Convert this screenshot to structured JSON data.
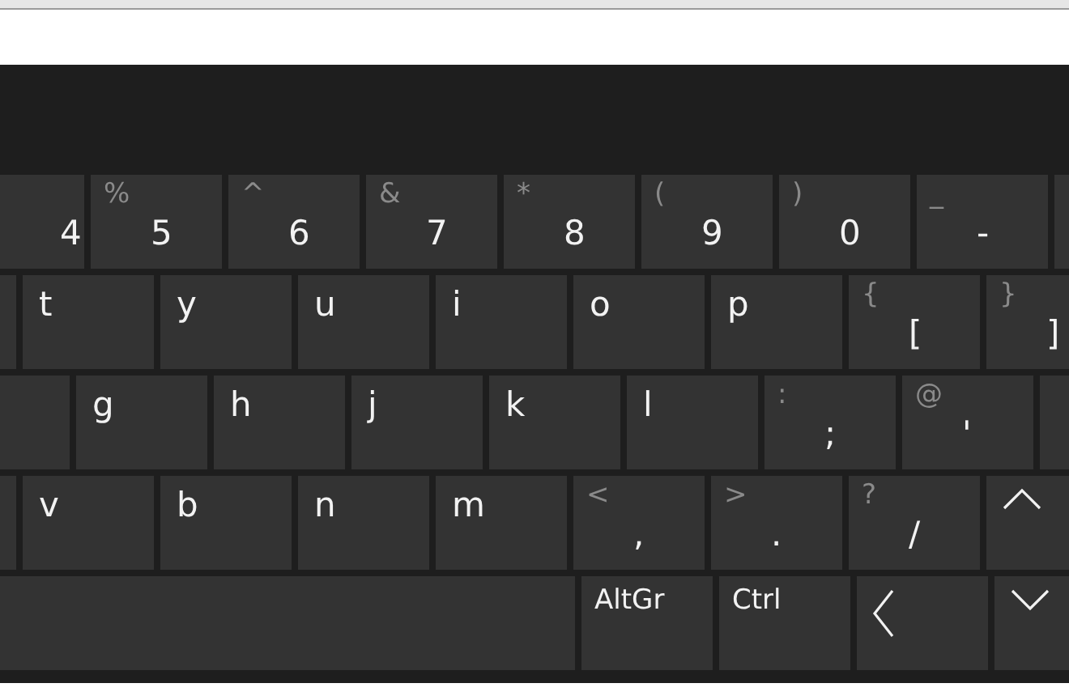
{
  "keyboard": {
    "rows": [
      {
        "keys": [
          {
            "kind": "symbol",
            "main": "4"
          },
          {
            "kind": "symbol",
            "main": "5",
            "shift": "%"
          },
          {
            "kind": "symbol",
            "main": "6",
            "shift": "^"
          },
          {
            "kind": "symbol",
            "main": "7",
            "shift": "&"
          },
          {
            "kind": "symbol",
            "main": "8",
            "shift": "*"
          },
          {
            "kind": "symbol",
            "main": "9",
            "shift": "("
          },
          {
            "kind": "symbol",
            "main": "0",
            "shift": ")"
          },
          {
            "kind": "symbol",
            "main": "-",
            "shift": "_"
          },
          {
            "kind": "blank"
          }
        ]
      },
      {
        "keys": [
          {
            "kind": "blank"
          },
          {
            "kind": "letter",
            "main": "t"
          },
          {
            "kind": "letter",
            "main": "y"
          },
          {
            "kind": "letter",
            "main": "u"
          },
          {
            "kind": "letter",
            "main": "i"
          },
          {
            "kind": "letter",
            "main": "o"
          },
          {
            "kind": "letter",
            "main": "p"
          },
          {
            "kind": "symbol",
            "main": "[",
            "shift": "{"
          },
          {
            "kind": "symbol",
            "main": "]",
            "shift": "}"
          }
        ]
      },
      {
        "keys": [
          {
            "kind": "blank"
          },
          {
            "kind": "letter",
            "main": "g"
          },
          {
            "kind": "letter",
            "main": "h"
          },
          {
            "kind": "letter",
            "main": "j"
          },
          {
            "kind": "letter",
            "main": "k"
          },
          {
            "kind": "letter",
            "main": "l"
          },
          {
            "kind": "symbol",
            "main": ";",
            "shift": ":"
          },
          {
            "kind": "symbol",
            "main": "'",
            "shift": "@"
          },
          {
            "kind": "blank"
          }
        ]
      },
      {
        "keys": [
          {
            "kind": "blank"
          },
          {
            "kind": "letter",
            "main": "v"
          },
          {
            "kind": "letter",
            "main": "b"
          },
          {
            "kind": "letter",
            "main": "n"
          },
          {
            "kind": "letter",
            "main": "m"
          },
          {
            "kind": "symbol",
            "main": ",",
            "shift": "<"
          },
          {
            "kind": "symbol",
            "main": ".",
            "shift": ">"
          },
          {
            "kind": "symbol",
            "main": "/",
            "shift": "?"
          },
          {
            "kind": "arrow-up"
          }
        ]
      },
      {
        "keys": [
          {
            "kind": "space"
          },
          {
            "kind": "label",
            "main": "AltGr"
          },
          {
            "kind": "label",
            "main": "Ctrl"
          },
          {
            "kind": "arrow-left"
          },
          {
            "kind": "arrow-down"
          }
        ]
      }
    ]
  }
}
